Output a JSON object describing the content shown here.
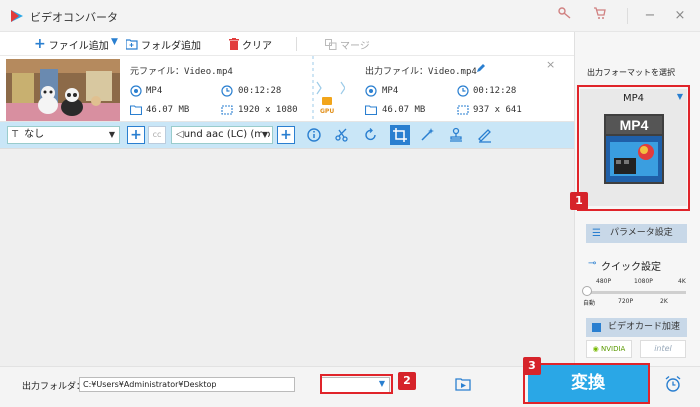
{
  "window": {
    "title": "ビデオコンバータ",
    "accent_color": "#2aa7e6",
    "highlight_color": "#e0242a"
  },
  "toolbar": {
    "add_file": "ファイル追加",
    "add_folder": "フォルダ追加",
    "clear": "クリア",
    "merge": "マージ"
  },
  "file": {
    "source_label": "元ファイル：",
    "source_name": "Video.mp4",
    "output_label": "出力ファイル：",
    "output_name": "Video.mp4",
    "source": {
      "format": "MP4",
      "duration": "00:12:28",
      "size": "46.07 MB",
      "resolution": "1920 x 1080"
    },
    "output": {
      "format": "MP4",
      "duration": "00:12:28",
      "size": "46.07 MB",
      "resolution": "937 x 641"
    },
    "gpu_label": "GPU"
  },
  "editbar": {
    "subtitle_value": "なし",
    "audio_value": "und aac (LC) (mp"
  },
  "output_panel": {
    "title": "出力フォーマットを選択",
    "format_name": "MP4",
    "tile_text": "MP4",
    "params_button": "パラメータ設定",
    "quick_settings": "クイック設定",
    "ticks_top": [
      "480P",
      "1080P",
      "4K"
    ],
    "ticks_bottom": [
      "自動",
      "720P",
      "2K"
    ],
    "quality_level": 0.0,
    "gpu_accel": "ビデオカード加速",
    "nvidia": "NVIDIA",
    "intel": "intel"
  },
  "bottom": {
    "output_folder_label": "出力フォルダ：",
    "output_folder_path": "C:¥Users¥Administrator¥Desktop",
    "convert_button": "変換"
  },
  "badges": [
    "1",
    "2",
    "3"
  ]
}
